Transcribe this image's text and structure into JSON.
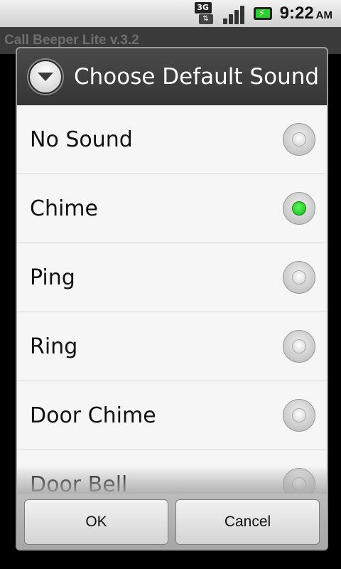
{
  "status_bar": {
    "time": "9:22",
    "ampm": "AM",
    "network_label": "3G",
    "icons": [
      "3g-data-icon",
      "signal-icon",
      "battery-charging-icon"
    ]
  },
  "app": {
    "title": "Call Beeper Lite v.3.2"
  },
  "dialog": {
    "title": "Choose Default Sound",
    "icon": "dropdown-icon",
    "options": [
      {
        "label": "No Sound",
        "selected": false
      },
      {
        "label": "Chime",
        "selected": true
      },
      {
        "label": "Ping",
        "selected": false
      },
      {
        "label": "Ring",
        "selected": false
      },
      {
        "label": "Door Chime",
        "selected": false
      },
      {
        "label": "Door Bell",
        "selected": false
      }
    ],
    "buttons": {
      "ok": "OK",
      "cancel": "Cancel"
    }
  },
  "colors": {
    "accent_selected": "#22cc22",
    "header_bg": "#3d3d3d"
  }
}
